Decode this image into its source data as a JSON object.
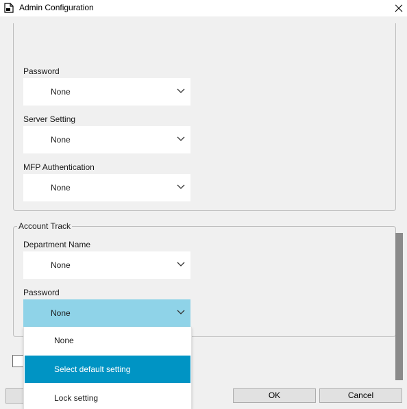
{
  "window": {
    "title": "Admin Configuration",
    "app_icon": "document-icon",
    "close_icon": "close-icon"
  },
  "fields": {
    "password1": {
      "label": "Password",
      "value": "None"
    },
    "server_setting": {
      "label": "Server Setting",
      "value": "None"
    },
    "mfp_auth": {
      "label": "MFP Authentication",
      "value": "None"
    },
    "department_name": {
      "label": "Department Name",
      "value": "None"
    },
    "password2": {
      "label": "Password",
      "value": "None"
    }
  },
  "account_track": {
    "legend": "Account Track"
  },
  "dropdown": {
    "options": [
      "None",
      "Select default setting",
      "Lock setting"
    ],
    "highlighted": "Select default setting"
  },
  "buttons": {
    "ok": "OK",
    "cancel": "Cancel"
  },
  "colors": {
    "focused_select": "#8fd3e8",
    "selected_option": "#0094c4"
  }
}
